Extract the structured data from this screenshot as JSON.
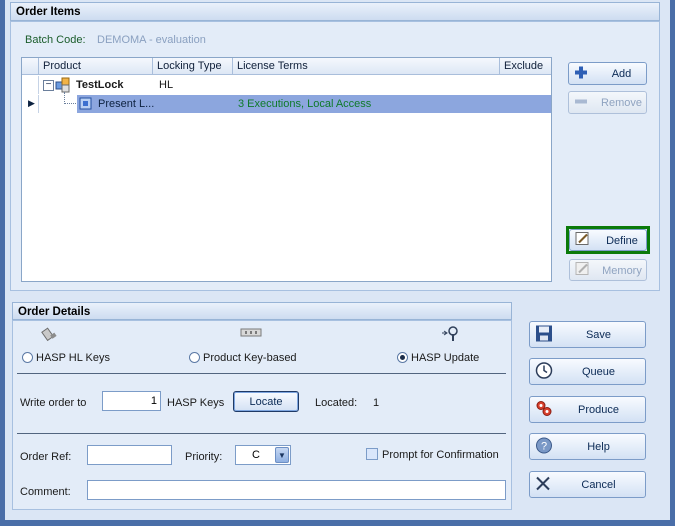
{
  "order_items": {
    "title": "Order Items",
    "batch_code_label": "Batch Code:",
    "batch_code_value": "DEMOMA - evaluation",
    "columns": [
      "Product",
      "Locking Type",
      "License Terms",
      "Exclude"
    ],
    "rows": [
      {
        "product": "TestLock",
        "locking_type": "HL",
        "license_terms": "",
        "exclude": ""
      },
      {
        "product": "Present L...",
        "locking_type": "",
        "license_terms": "3 Executions, Local Access",
        "exclude": ""
      }
    ],
    "buttons": {
      "add": "Add",
      "remove": "Remove",
      "define": "Define",
      "memory": "Memory"
    }
  },
  "order_details": {
    "title": "Order Details",
    "radios": [
      "HASP HL Keys",
      "Product Key-based",
      "HASP Update"
    ],
    "selected_radio": "HASP Update",
    "write_order_label": "Write order to",
    "write_order_count": "1",
    "hasp_keys_label": "HASP Keys",
    "locate_button": "Locate",
    "located_label": "Located:",
    "located_value": "1",
    "order_ref_label": "Order Ref:",
    "priority_label": "Priority:",
    "priority_value": "C",
    "prompt_label": "Prompt for Confirmation",
    "comment_label": "Comment:"
  },
  "side_buttons": {
    "save": "Save",
    "queue": "Queue",
    "produce": "Produce",
    "help": "Help",
    "cancel": "Cancel"
  },
  "colors": {
    "selected_row": "#8ca6de",
    "terms_text": "#0f7a2a",
    "batch_value": "#8aa0c0",
    "define_highlight": "#0a7a0a"
  }
}
